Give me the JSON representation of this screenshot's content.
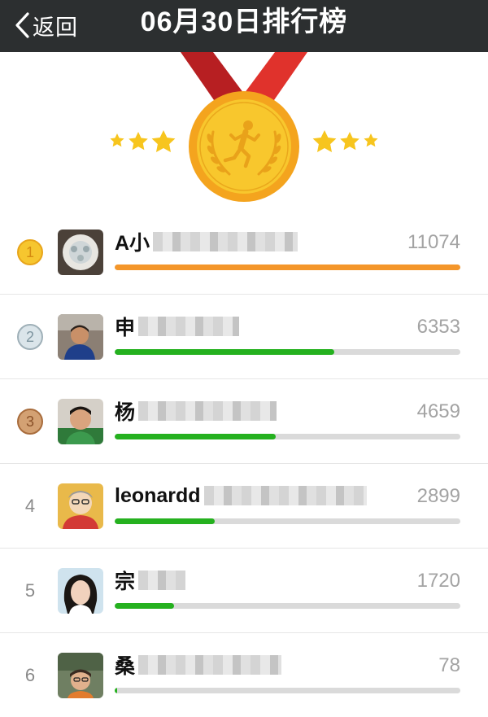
{
  "header": {
    "back_label": "返回",
    "title": "06月30日排行榜"
  },
  "colors": {
    "topbar": "#2c2f30",
    "first_bar": "#f4962a",
    "bar": "#25b11f",
    "track": "#dadada",
    "medal_gold": "#f6c62f",
    "ribbon_red": "#d7282a"
  },
  "entries": [
    {
      "rank": "1",
      "name": "A小",
      "score": "11074",
      "progress": 1.0
    },
    {
      "rank": "2",
      "name": "申",
      "score": "6353",
      "progress": 0.6353
    },
    {
      "rank": "3",
      "name": "杨",
      "score": "4659",
      "progress": 0.4659
    },
    {
      "rank": "4",
      "name": "leonardd",
      "score": "2899",
      "progress": 0.2899
    },
    {
      "rank": "5",
      "name": "宗",
      "score": "1720",
      "progress": 0.172
    },
    {
      "rank": "6",
      "name": "桑",
      "score": "78",
      "progress": 0.0078
    }
  ]
}
